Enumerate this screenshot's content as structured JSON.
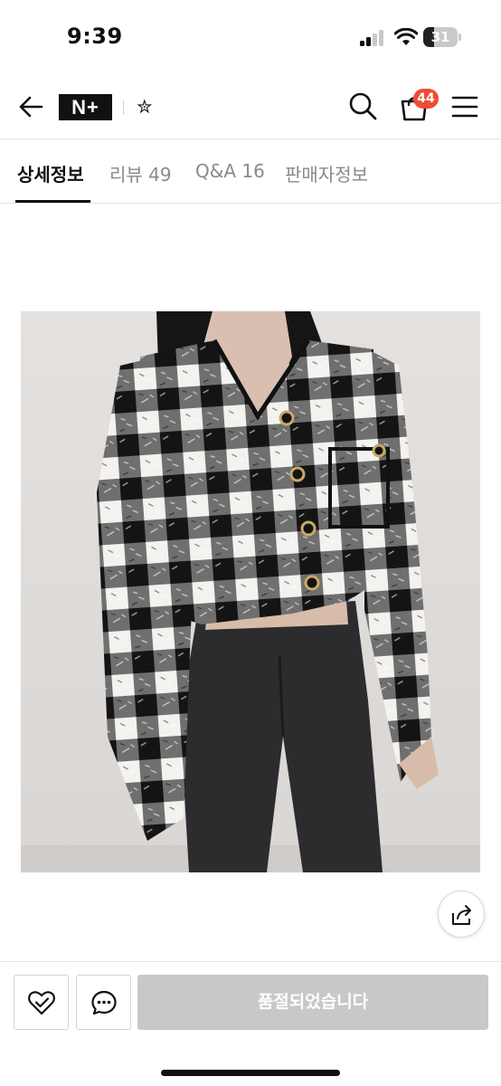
{
  "status_bar": {
    "time": "9:39",
    "battery_level": "31",
    "battery_fraction": 0.31
  },
  "header": {
    "back_icon": "arrow-left-icon",
    "brand_logo": "N+",
    "star_mark": "✮",
    "search_icon": "search-icon",
    "cart_icon": "shopping-bag-icon",
    "cart_count": "44",
    "menu_icon": "hamburger-menu-icon",
    "badge_color": "#ef4b35"
  },
  "tabs": [
    {
      "label": "상세정보",
      "active": true
    },
    {
      "label": "리뷰 49",
      "active": false
    },
    {
      "label": "Q&A 16",
      "active": false
    },
    {
      "label": "판매자정보",
      "active": false
    }
  ],
  "product": {
    "image_icon": "product-photo-tweed-check-jacket",
    "share_icon": "share-icon"
  },
  "bottom_bar": {
    "wishlist_icon": "heart-check-icon",
    "chat_icon": "chat-bubble-icon",
    "soldout_label": "품절되었습니다",
    "soldout_color": "#c8c8c8"
  }
}
